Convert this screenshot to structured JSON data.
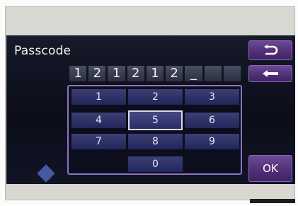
{
  "screen": {
    "title": "Passcode"
  },
  "passcode": {
    "cells": [
      "1",
      "2",
      "1",
      "2",
      "1",
      "2",
      "_",
      "",
      ""
    ]
  },
  "keypad": {
    "keys": [
      "1",
      "2",
      "3",
      "4",
      "5",
      "6",
      "7",
      "8",
      "9",
      "0"
    ],
    "selected_key": "5"
  },
  "buttons": {
    "back_icon": "return-arrow-icon",
    "backspace_icon": "left-arrow-icon",
    "ok_label": "OK"
  },
  "colors": {
    "accent_purple": "#5a3a84",
    "frame_purple": "#8c74c0",
    "key_blue": "#2c3068",
    "display_bg": "#101426"
  }
}
